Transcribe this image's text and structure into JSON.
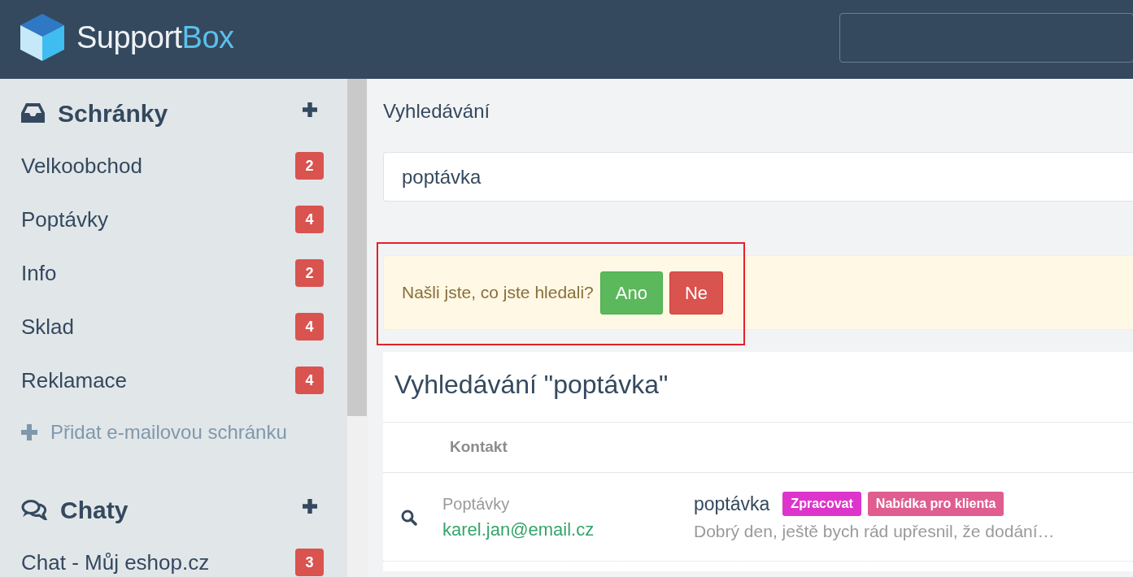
{
  "header": {
    "logo": {
      "text": "Support",
      "accent": "Box"
    }
  },
  "sidebar": {
    "sections": [
      {
        "kind": "inbox",
        "title": "Schránky",
        "items": [
          {
            "label": "Velkoobchod",
            "count": "2"
          },
          {
            "label": "Poptávky",
            "count": "4"
          },
          {
            "label": "Info",
            "count": "2"
          },
          {
            "label": "Sklad",
            "count": "4"
          },
          {
            "label": "Reklamace",
            "count": "4"
          }
        ],
        "add_link": "Přidat e-mailovou schránku"
      },
      {
        "kind": "chat",
        "title": "Chaty",
        "items": [
          {
            "label": "Chat - Můj eshop.cz",
            "count": "3"
          }
        ]
      }
    ]
  },
  "main": {
    "page_title": "Vyhledávání",
    "search": {
      "value": "poptávka"
    },
    "feedback": {
      "question": "Našli jste, co jste hledali?",
      "highlighted": true,
      "buttons": [
        {
          "label": "Ano",
          "kind": "yes"
        },
        {
          "label": "Ne",
          "kind": "no"
        }
      ]
    },
    "results": {
      "title": "Vyhledávání \"poptávka\"",
      "columns": [
        "Kontakt"
      ],
      "rows": [
        {
          "mailbox": "Poptávky",
          "email": "karel.jan@email.cz",
          "subject": "poptávka",
          "tags": [
            {
              "label": "Zpracovat",
              "color": "#dd35cc"
            },
            {
              "label": "Nabídka pro klienta",
              "color": "#e05d8f"
            }
          ],
          "preview": "Dobrý den, ještě bych rád upřesnil, že dodání…"
        }
      ]
    }
  }
}
